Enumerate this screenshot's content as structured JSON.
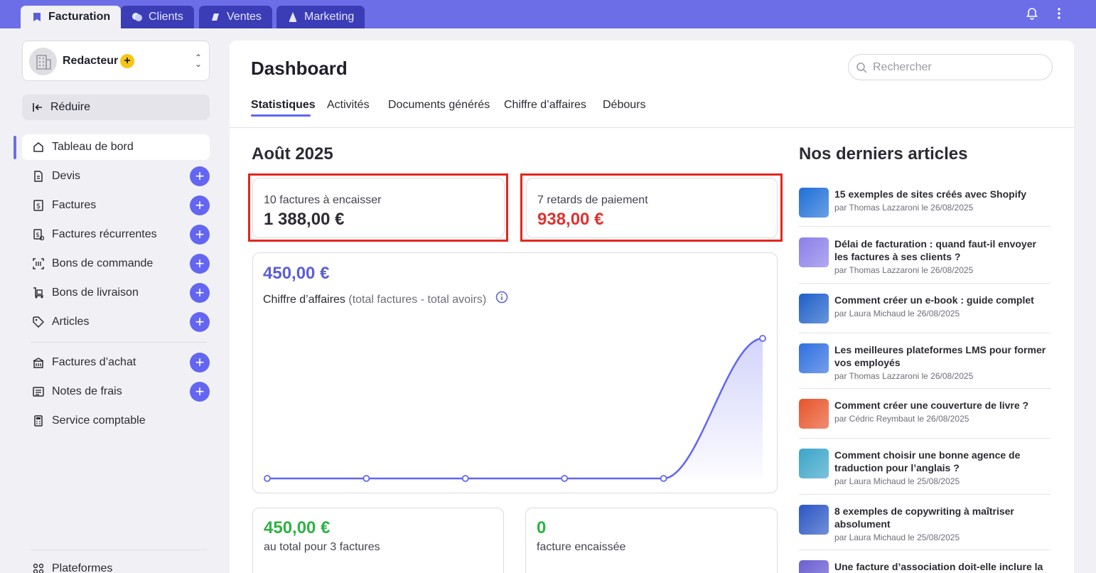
{
  "topbar": {
    "tabs": [
      {
        "label": "Facturation",
        "icon": "invoice-icon",
        "active": true
      },
      {
        "label": "Clients",
        "icon": "clients-icon",
        "active": false
      },
      {
        "label": "Ventes",
        "icon": "sales-icon",
        "active": false
      },
      {
        "label": "Marketing",
        "icon": "marketing-icon",
        "active": false
      }
    ]
  },
  "sidebar": {
    "org_name": "Redacteur",
    "org_badge": "+",
    "reduce_label": "Réduire",
    "items": [
      {
        "label": "Tableau de bord",
        "icon": "home-icon",
        "active": true
      },
      {
        "label": "Devis",
        "icon": "quote-icon"
      },
      {
        "label": "Factures",
        "icon": "invoice-dollar-icon"
      },
      {
        "label": "Factures récurrentes",
        "icon": "recurring-invoice-icon"
      },
      {
        "label": "Bons de commande",
        "icon": "purchase-order-icon"
      },
      {
        "label": "Bons de livraison",
        "icon": "delivery-icon"
      },
      {
        "label": "Articles",
        "icon": "tag-icon"
      },
      {
        "label": "Factures d’achat",
        "icon": "purchase-invoice-icon"
      },
      {
        "label": "Notes de frais",
        "icon": "expense-icon"
      },
      {
        "label": "Service comptable",
        "icon": "calculator-icon"
      },
      {
        "label": "Plateformes",
        "icon": "platforms-icon"
      }
    ]
  },
  "main": {
    "title": "Dashboard",
    "search_placeholder": "Rechercher",
    "tabs": [
      "Statistiques",
      "Activités",
      "Documents générés",
      "Chiffre d’affaires",
      "Débours"
    ],
    "month": "Août 2025",
    "kpi_to_collect": {
      "label": "10 factures à encaisser",
      "value": "1 388,00 €"
    },
    "kpi_late": {
      "label": "7 retards de paiement",
      "value": "938,00 €"
    },
    "revenue": {
      "value": "450,00 €",
      "title": "Chiffre d’affaires",
      "subtitle": "(total factures - total avoirs)"
    },
    "total_card": {
      "value": "450,00 €",
      "label": "au total pour 3 factures"
    },
    "collected_card": {
      "value": "0",
      "label": "facture encaissée"
    }
  },
  "chart_data": {
    "type": "area",
    "title": "",
    "xlabel": "",
    "ylabel": "",
    "x": [
      1,
      2,
      3,
      4,
      5,
      6
    ],
    "values": [
      0,
      0,
      0,
      0,
      0,
      450
    ],
    "ylim": [
      0,
      450
    ],
    "grid": false,
    "color": "#6366f1"
  },
  "articles": {
    "title": "Nos derniers articles",
    "items": [
      {
        "title": "15 exemples de sites créés avec Shopify",
        "meta": "par Thomas Lazzaroni le 26/08/2025",
        "color": "#1f6fd8"
      },
      {
        "title": "Délai de facturation : quand faut-il envoyer les factures à ses clients ?",
        "meta": "par Thomas Lazzaroni le 26/08/2025",
        "color": "#8b7fe8"
      },
      {
        "title": "Comment créer un e-book : guide complet",
        "meta": "par Laura Michaud le 26/08/2025",
        "color": "#1e5fc9"
      },
      {
        "title": "Les meilleures plateformes LMS pour former vos employés",
        "meta": "par Thomas Lazzaroni le 26/08/2025",
        "color": "#2f6fe0"
      },
      {
        "title": "Comment créer une couverture de livre ?",
        "meta": "par Cédric Reymbaut le 26/08/2025",
        "color": "#e8542a"
      },
      {
        "title": "Comment choisir une bonne agence de traduction pour l’anglais ?",
        "meta": "par Laura Michaud le 25/08/2025",
        "color": "#3aa5c9"
      },
      {
        "title": "8 exemples de copywriting à maîtriser absolument",
        "meta": "par Laura Michaud le 25/08/2025",
        "color": "#2a56c4"
      },
      {
        "title": "Une facture d’association doit-elle inclure la",
        "meta": "",
        "color": "#6b5fd0"
      }
    ]
  }
}
